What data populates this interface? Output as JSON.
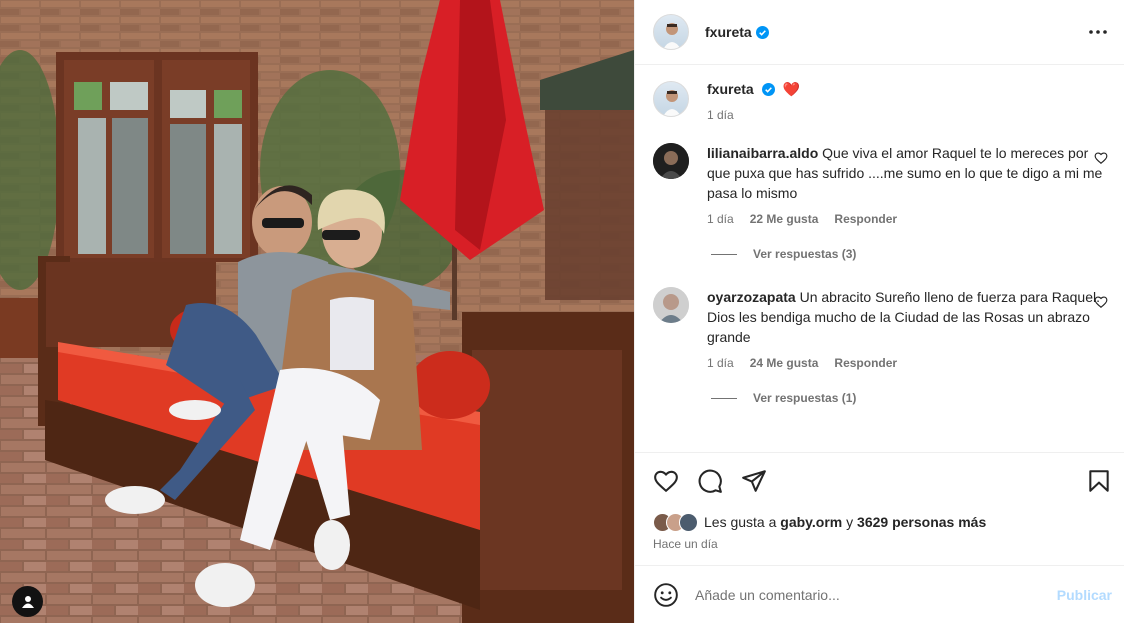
{
  "post": {
    "owner": "fxureta",
    "photo_alt": "",
    "caption_emoji": "❤️",
    "caption_age": "1 día"
  },
  "comments": [
    {
      "user": "lilianaibarra.aldo",
      "text": "Que viva el amor Raquel te lo mereces por que puxa que has sufrido ....me sumo en lo que te digo a mi me pasa lo mismo",
      "age": "1 día",
      "likes": "22 Me gusta",
      "reply": "Responder",
      "view_replies": "Ver respuestas (3)"
    },
    {
      "user": "oyarzozapata",
      "text": "Un abracito Sureño lleno de fuerza para Raquel. Dios les bendiga mucho de la Ciudad de las Rosas un abrazo grande",
      "age": "1 día",
      "likes": "24 Me gusta",
      "reply": "Responder",
      "view_replies": "Ver respuestas (1)"
    }
  ],
  "likes": {
    "prefix": "Les gusta a",
    "first_user": "gaby.orm",
    "joiner": "y",
    "others": "3629 personas más"
  },
  "posted": "Hace un día",
  "composer": {
    "placeholder": "Añade un comentario...",
    "publish": "Publicar"
  },
  "icons": {
    "more": "more-horizontal-icon",
    "like": "heart-icon",
    "comment": "comment-icon",
    "share": "paper-plane-icon",
    "save": "bookmark-icon",
    "emoji": "smiley-icon",
    "tag": "user-tag-icon",
    "verified": "verified-badge-icon"
  },
  "colors": {
    "verified": "#0095f6",
    "publish_disabled": "#b3dbff",
    "heart": "#ff3040"
  }
}
